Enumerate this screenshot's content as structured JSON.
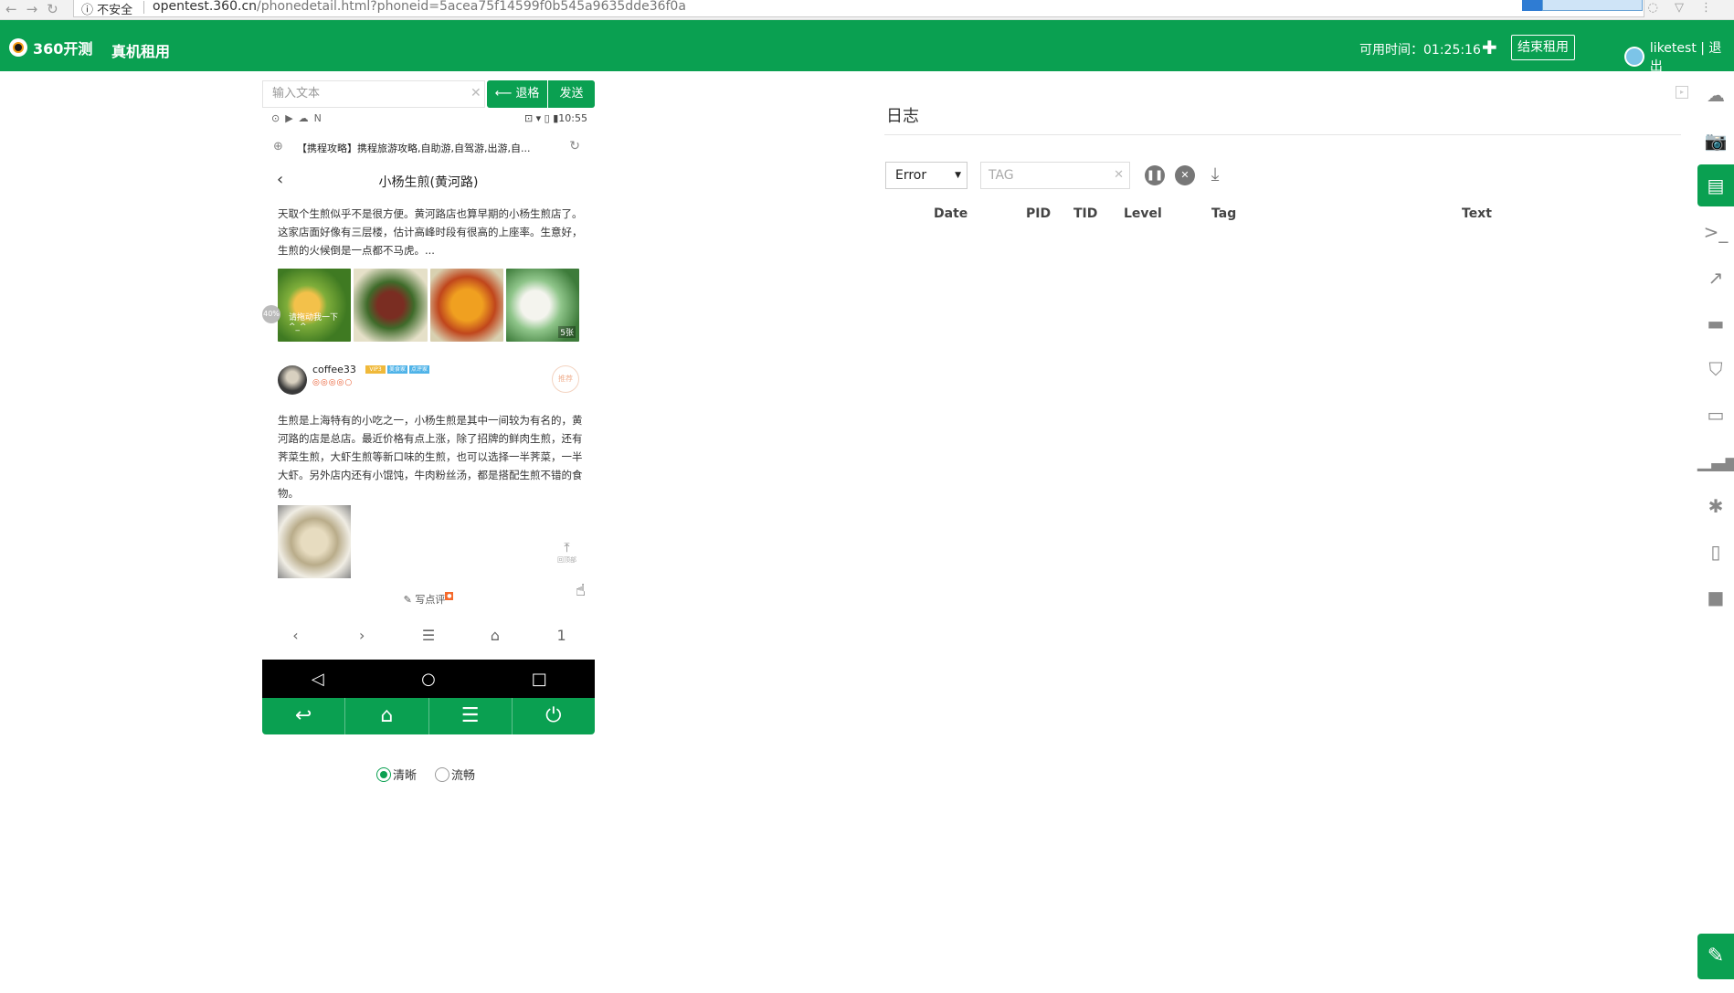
{
  "browser": {
    "security": "ⓘ 不安全",
    "url_host": "opentest.360.cn",
    "url_rest": "/phonedetail.html?phoneid=5acea75f14599f0b545a9635dde36f0a"
  },
  "header": {
    "logo": "360开测",
    "menu": "真机租用",
    "timer": "可用时间：01:25:16",
    "end_rent": "结束租用",
    "user": "liketest | 退出"
  },
  "phone": {
    "input_placeholder": "输入文本",
    "backspace_label": "⟵ 退格",
    "send_label": "发送",
    "time": "10:55",
    "page_url_title": "【携程攻略】携程旅游攻略,自助游,自驾游,出游,自...",
    "page_title": "小杨生煎(黄河路)",
    "intro": "天取个生煎似乎不是很方便。黄河路店也算早期的小杨生煎店了。这家店面好像有三层楼，估计高峰时段有很高的上座率。生意好，生煎的火候倒是一点都不马虎。...",
    "photo_caption": "请拖动我一下^_^",
    "photo_count": "5张",
    "progress_badge": "40%",
    "commenter_name": "coffee33",
    "badge_labels": [
      "VIP3",
      "美食家",
      "点评家"
    ],
    "stars": "◎◎◎◎○",
    "seal_text": "推荐",
    "review": "生煎是上海特有的小吃之一，小杨生煎是其中一间较为有名的，黄河路的店是总店。最近价格有点上涨，除了招牌的鲜肉生煎，还有荠菜生煎，大虾生煎等新口味的生煎，也可以选择一半荠菜，一半大虾。另外店内还有小馄饨，牛肉粉丝汤，都是搭配生煎不错的食物。",
    "to_top_label": "回顶部",
    "write_review": "写点评",
    "tab_count": "1"
  },
  "quality": {
    "clear": "清晰",
    "smooth": "流畅"
  },
  "log": {
    "title": "日志",
    "level": "Error",
    "tag_placeholder": "TAG",
    "columns": [
      "Date",
      "PID",
      "TID",
      "Level",
      "Tag",
      "Text"
    ]
  },
  "colors": {
    "brand_green": "#0aa051"
  }
}
